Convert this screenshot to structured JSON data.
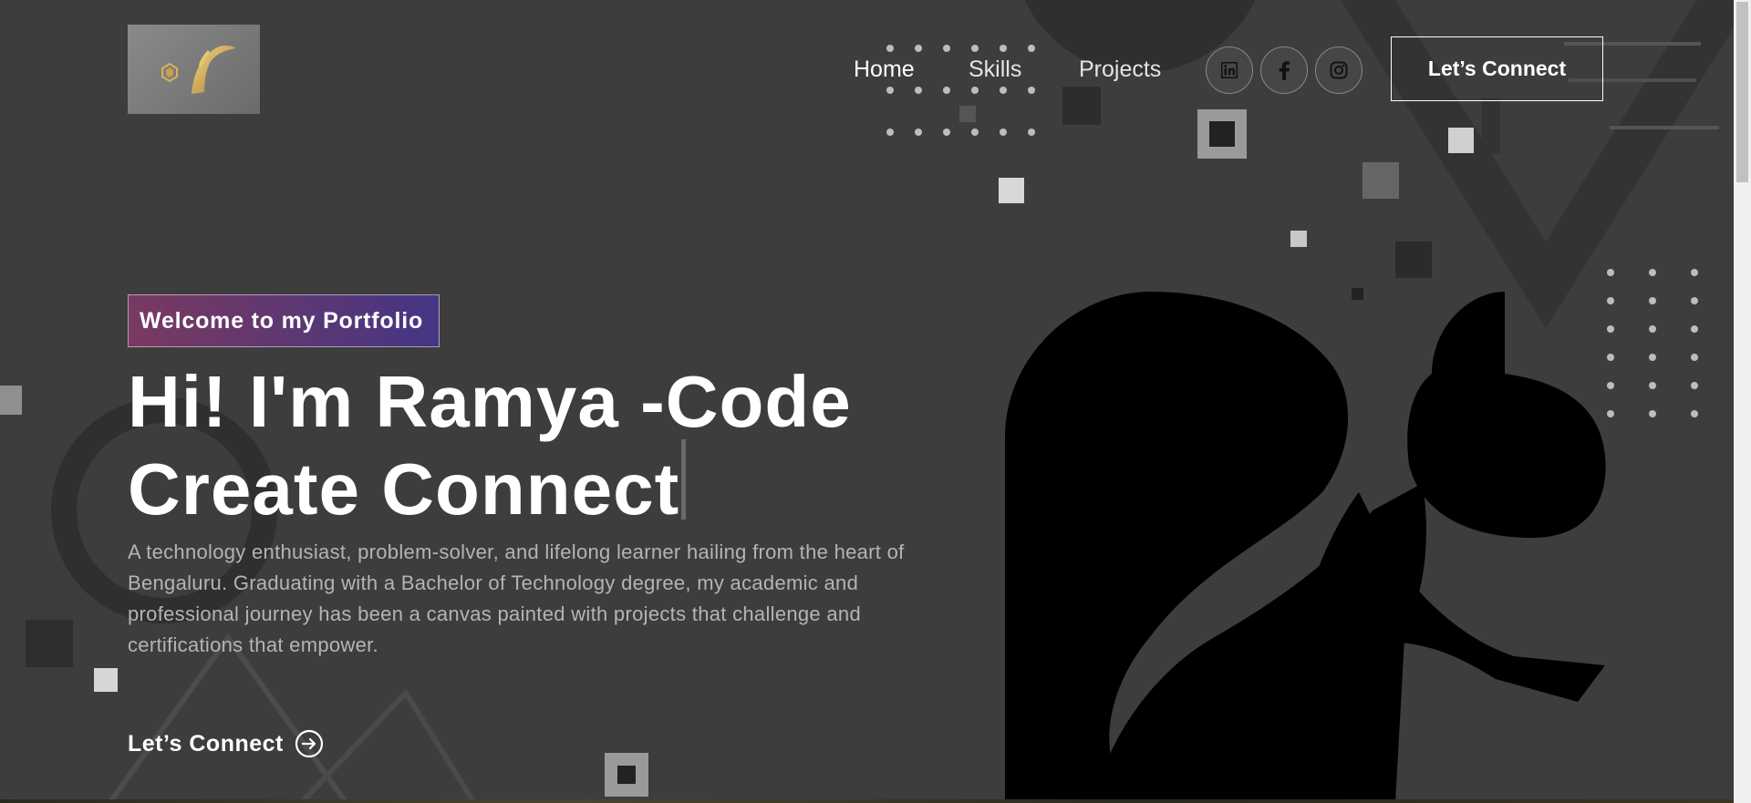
{
  "header": {
    "logo_icon": "brand-r-logo-icon",
    "nav": [
      {
        "label": "Home"
      },
      {
        "label": "Skills"
      },
      {
        "label": "Projects"
      }
    ],
    "socials": [
      {
        "icon": "linkedin-icon"
      },
      {
        "icon": "facebook-icon"
      },
      {
        "icon": "instagram-icon"
      }
    ],
    "connect_label": "Let’s Connect"
  },
  "hero": {
    "tagline": "Welcome to my Portfolio",
    "headline_line1": "Hi! I'm Ramya -Code",
    "headline_line2": "Create Connect",
    "intro": "A technology enthusiast, problem-solver, and lifelong learner hailing from the heart of Bengaluru. Graduating with a Bachelor of Technology degree, my academic and professional journey has been a canvas painted with projects that challenge and certifications that empower.",
    "cta_label": "Let’s Connect",
    "cta_icon": "arrow-circle-right-icon"
  },
  "colors": {
    "background": "#3d3d3d",
    "tagline_gradient_start": "#aa367c",
    "tagline_gradient_end": "#4a2fbd",
    "text": "#ffffff",
    "muted_text": "#b4b4b4"
  }
}
